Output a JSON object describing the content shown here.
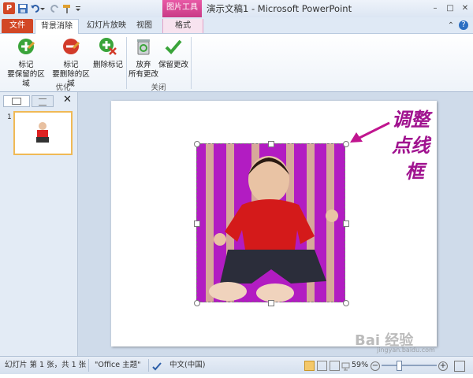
{
  "title_bar": {
    "app_icon_letter": "P",
    "contextual_tab_group": "图片工具",
    "window_title": "演示文稿1 - Microsoft PowerPoint"
  },
  "tabs": [
    {
      "label": "文件"
    },
    {
      "label": "背景消除"
    },
    {
      "label": "幻灯片放映"
    },
    {
      "label": "视图"
    },
    {
      "label": "格式"
    }
  ],
  "ribbon": {
    "groups": [
      {
        "label": "优化",
        "buttons": [
          {
            "label_line1": "标记",
            "label_line2": "要保留的区域"
          },
          {
            "label_line1": "标记",
            "label_line2": "要删除的区域"
          },
          {
            "label_line1": "删除标记",
            "label_line2": ""
          }
        ]
      },
      {
        "label": "关闭",
        "buttons": [
          {
            "label_line1": "放弃",
            "label_line2": "所有更改"
          },
          {
            "label_line1": "保留更改",
            "label_line2": ""
          }
        ]
      }
    ]
  },
  "slides_pane": {
    "slide_number": "1"
  },
  "annotation": {
    "line1": "调整",
    "line2": "点线",
    "line3": "框"
  },
  "status_bar": {
    "slide_info": "幻灯片 第 1 张，共 1 张",
    "theme": "\"Office 主题\"",
    "language": "中文(中国)",
    "zoom": "59%"
  },
  "watermark": {
    "text": "Bai 经验",
    "sub": "jingyan.baidu.com"
  },
  "colors": {
    "file_tab": "#d24726",
    "contextual_tab": "#d24a97",
    "annotation": "#a0138f",
    "picture_background": "#b21cc2"
  }
}
